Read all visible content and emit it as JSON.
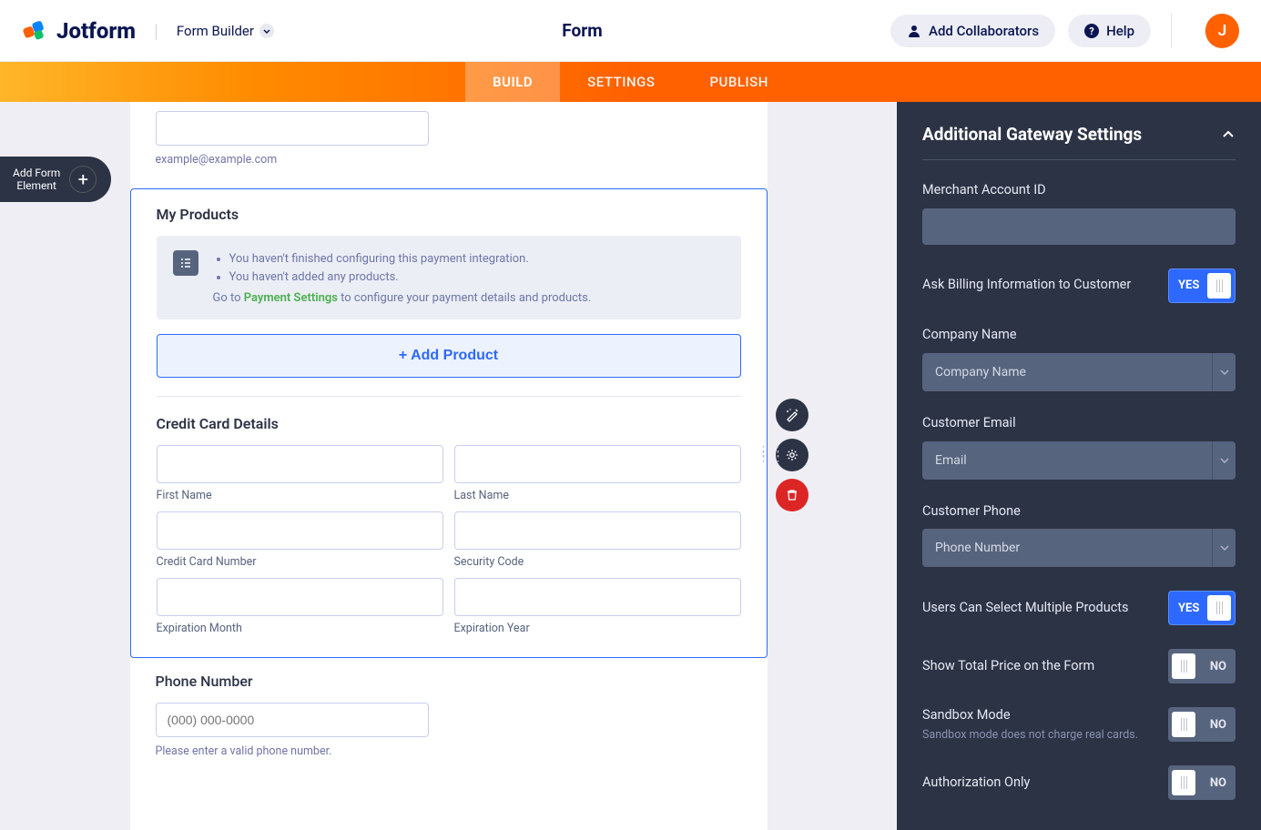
{
  "header": {
    "brand": "Jotform",
    "builder_label": "Form Builder",
    "form_title": "Form",
    "collaborators_label": "Add Collaborators",
    "help_label": "Help",
    "avatar_letter": "J"
  },
  "nav": {
    "tabs": [
      "BUILD",
      "SETTINGS",
      "PUBLISH"
    ]
  },
  "add_element": {
    "line1": "Add Form",
    "line2": "Element"
  },
  "email_field": {
    "helper": "example@example.com"
  },
  "products_block": {
    "title": "My Products",
    "warn1": "You haven't finished configuring this payment integration.",
    "warn2": "You haven't added any products.",
    "cta_prefix": "Go to ",
    "cta_link": "Payment Settings",
    "cta_suffix": " to configure your payment details and products.",
    "add_btn": "+ Add Product"
  },
  "cc_block": {
    "title": "Credit Card Details",
    "labels": {
      "first_name": "First Name",
      "last_name": "Last Name",
      "cc_number": "Credit Card Number",
      "sec_code": "Security Code",
      "exp_month": "Expiration Month",
      "exp_year": "Expiration Year"
    }
  },
  "phone_block": {
    "title": "Phone Number",
    "placeholder": "(000) 000-0000",
    "helper": "Please enter a valid phone number."
  },
  "panel": {
    "title": "Additional Gateway Settings",
    "settings": {
      "merchant_id": "Merchant Account ID",
      "ask_billing": "Ask Billing Information to Customer",
      "company_name": "Company Name",
      "company_name_value": "Company Name",
      "customer_email": "Customer Email",
      "customer_email_value": "Email",
      "customer_phone": "Customer Phone",
      "customer_phone_value": "Phone Number",
      "multi_products": "Users Can Select Multiple Products",
      "show_total": "Show Total Price on the Form",
      "sandbox": "Sandbox Mode",
      "sandbox_sub": "Sandbox mode does not charge real cards.",
      "auth_only": "Authorization Only"
    },
    "toggle_yes": "YES",
    "toggle_no": "NO"
  }
}
